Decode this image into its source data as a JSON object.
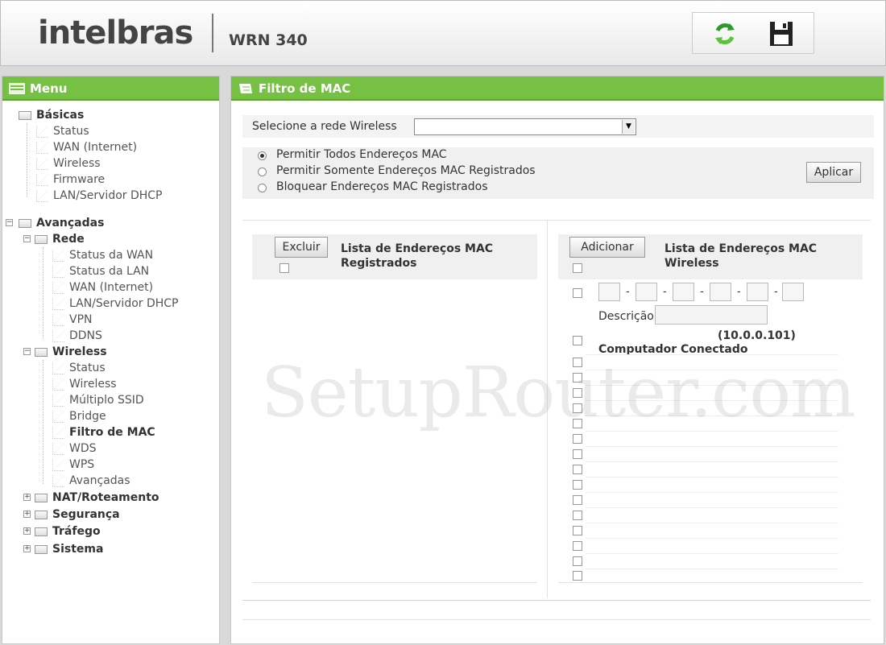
{
  "header": {
    "brand": "intelbras",
    "model": "WRN 340"
  },
  "menu": {
    "title": "Menu",
    "basicas": {
      "label": "Básicas",
      "items": [
        "Status",
        "WAN (Internet)",
        "Wireless",
        "Firmware",
        "LAN/Servidor DHCP"
      ]
    },
    "avancadas": {
      "label": "Avançadas",
      "rede": {
        "label": "Rede",
        "items": [
          "Status da WAN",
          "Status da LAN",
          "WAN (Internet)",
          "LAN/Servidor DHCP",
          "VPN",
          "DDNS"
        ]
      },
      "wireless": {
        "label": "Wireless",
        "items": [
          "Status",
          "Wireless",
          "Múltiplo SSID",
          "Bridge",
          "Filtro de MAC",
          "WDS",
          "WPS",
          "Avançadas"
        ]
      },
      "others": [
        "NAT/Roteamento",
        "Segurança",
        "Tráfego",
        "Sistema"
      ]
    }
  },
  "content": {
    "title": "Filtro de MAC",
    "select_label": "Selecione a rede Wireless",
    "select_value": "",
    "radio_options": [
      "Permitir Todos Endereços MAC",
      "Permitir Somente Endereços MAC Registrados",
      "Bloquear Endereços MAC Registrados"
    ],
    "selected_radio": 0,
    "apply_label": "Aplicar",
    "left_list": {
      "button": "Excluir",
      "title_line1": "Lista de Endereços MAC",
      "title_line2": "Registrados"
    },
    "right_list": {
      "button": "Adicionar",
      "title_line1": "Lista de Endereços MAC",
      "title_line2": "Wireless",
      "desc_label": "Descrição",
      "ip": "(10.0.0.101)",
      "connected": "Computador Conectado"
    }
  },
  "watermark": "SetupRouter.com",
  "colors": {
    "accent": "#76c043",
    "header_bg": "#f2f2f2",
    "body_bg": "#d9d9d9"
  }
}
